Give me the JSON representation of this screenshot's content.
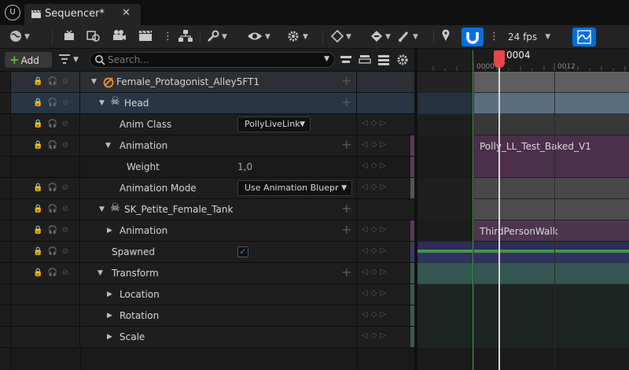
{
  "title_bar": {
    "logo_icon": "unreal-logo-icon",
    "tab_label": "Sequencer*",
    "close_glyph": "✕"
  },
  "toolbar": {
    "fps_label": "24 fps",
    "accent": "#0070e0"
  },
  "outliner": {
    "add_label": "Add",
    "search_placeholder": "Search...",
    "rows": [
      {
        "label": "Female_Protagonist_Alley5FT1"
      },
      {
        "label": "Head"
      },
      {
        "label": "Anim Class",
        "value": "PollyLiveLink"
      },
      {
        "label": "Animation"
      },
      {
        "label": "Weight",
        "value": "1,0"
      },
      {
        "label": "Animation Mode",
        "value": "Use Animation Bluepr"
      },
      {
        "label": "SK_Petite_Female_Tank"
      },
      {
        "label": "Animation"
      },
      {
        "label": "Spawned",
        "checked": true
      },
      {
        "label": "Transform"
      },
      {
        "label": "Location"
      },
      {
        "label": "Rotation"
      },
      {
        "label": "Scale"
      }
    ]
  },
  "timeline": {
    "current_frame": "0004",
    "ticks": [
      "0000",
      "0012"
    ],
    "sections": [
      {
        "label": "Polly_LL_Test_Baked_V1"
      },
      {
        "label": "ThirdPersonWalk"
      }
    ]
  }
}
